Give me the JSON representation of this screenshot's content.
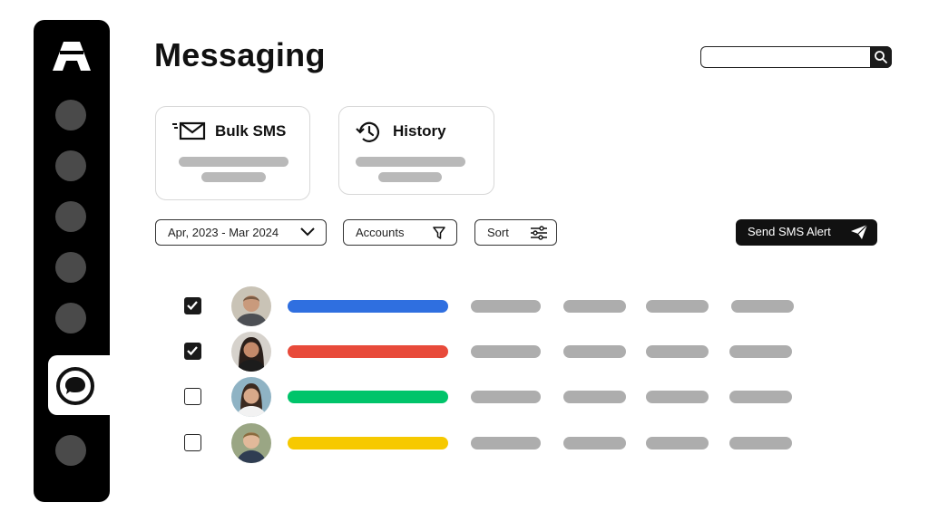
{
  "app": {
    "title": "Messaging"
  },
  "sidebar": {
    "items": [
      {
        "icon": "nav-placeholder-icon"
      },
      {
        "icon": "nav-placeholder-icon"
      },
      {
        "icon": "nav-placeholder-icon"
      },
      {
        "icon": "nav-placeholder-icon"
      },
      {
        "icon": "nav-placeholder-icon"
      },
      {
        "icon": "chat-bubble-icon",
        "active": true
      },
      {
        "icon": "nav-placeholder-icon"
      }
    ]
  },
  "search": {
    "placeholder": "",
    "value": ""
  },
  "cards": [
    {
      "label": "Bulk SMS",
      "icon": "mail-send-icon"
    },
    {
      "label": "History",
      "icon": "history-icon"
    }
  ],
  "filters": {
    "date_range": "Apr, 2023 - Mar 2024",
    "accounts": "Accounts",
    "sort": "Sort"
  },
  "actions": {
    "send_alert": "Send SMS Alert"
  },
  "colors": {
    "row_blue": "#2f6fe0",
    "row_red": "#e84a3a",
    "row_green": "#00c46a",
    "row_yellow": "#f6c900",
    "placeholder_gray": "#adadad"
  },
  "rows": [
    {
      "checked": true,
      "color": "#2f6fe0"
    },
    {
      "checked": true,
      "color": "#e84a3a"
    },
    {
      "checked": false,
      "color": "#00c46a"
    },
    {
      "checked": false,
      "color": "#f6c900"
    }
  ]
}
